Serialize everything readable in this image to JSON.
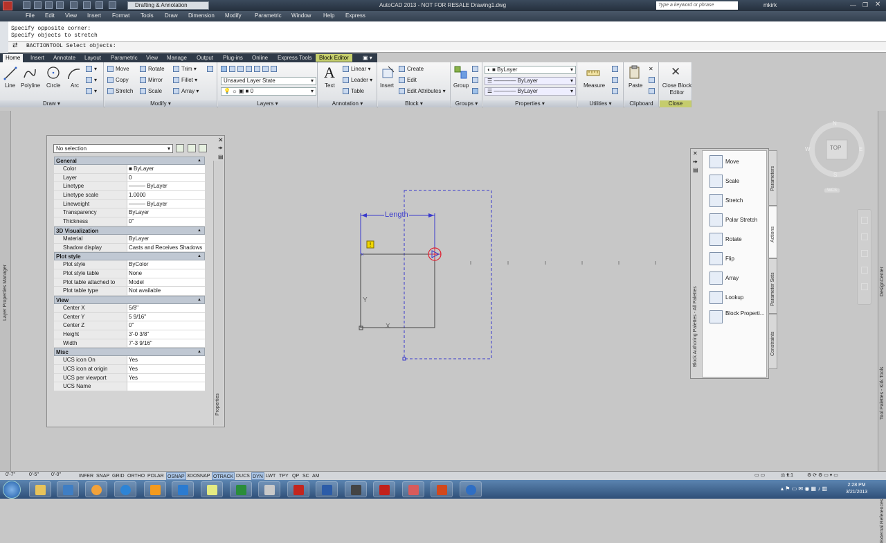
{
  "title_bar": {
    "title": "AutoCAD 2013 - NOT FOR RESALE   Drawing1.dwg",
    "workspace": "Drafting & Annotation",
    "search_placeholder": "Type a keyword or phrase",
    "user": "mkirk"
  },
  "menu": [
    "File",
    "Edit",
    "View",
    "Insert",
    "Format",
    "Tools",
    "Draw",
    "Dimension",
    "Modify",
    "Parametric",
    "Window",
    "Help",
    "Express"
  ],
  "command_line": {
    "history": [
      "Specify opposite corner:",
      "Specify objects to stretch"
    ],
    "prompt": "BACTIONTOOL Select objects:"
  },
  "ribbon_tabs": [
    "Home",
    "Insert",
    "Annotate",
    "Layout",
    "Parametric",
    "View",
    "Manage",
    "Output",
    "Plug-ins",
    "Online",
    "Express Tools",
    "Block Editor"
  ],
  "ribbon": {
    "draw": {
      "line": "Line",
      "polyline": "Polyline",
      "circle": "Circle",
      "arc": "Arc",
      "label": "Draw"
    },
    "modify": {
      "move": "Move",
      "rotate": "Rotate",
      "trim": "Trim",
      "copy": "Copy",
      "mirror": "Mirror",
      "fillet": "Fillet",
      "stretch": "Stretch",
      "scale": "Scale",
      "array": "Array",
      "label": "Modify"
    },
    "layers": {
      "state": "Unsaved Layer State",
      "current": "0",
      "label": "Layers"
    },
    "annotation": {
      "text": "Text",
      "linear": "Linear",
      "leader": "Leader",
      "table": "Table",
      "label": "Annotation"
    },
    "block": {
      "insert": "Insert",
      "create": "Create",
      "edit": "Edit",
      "edit_attributes": "Edit Attributes",
      "label": "Block"
    },
    "groups": {
      "group": "Group",
      "label": "Groups"
    },
    "properties": {
      "color": "ByLayer",
      "linetype": "ByLayer",
      "lineweight": "ByLayer",
      "label": "Properties"
    },
    "utilities": {
      "measure": "Measure",
      "label": "Utilities"
    },
    "clipboard": {
      "paste": "Paste",
      "label": "Clipboard"
    },
    "close": {
      "close_block_editor": "Close Block Editor",
      "label": "Close"
    }
  },
  "properties_palette": {
    "selection": "No selection",
    "side_label": "Properties",
    "sections": [
      {
        "name": "General",
        "rows": [
          [
            "Color",
            "■ ByLayer"
          ],
          [
            "Layer",
            "0"
          ],
          [
            "Linetype",
            "——— ByLayer"
          ],
          [
            "Linetype scale",
            "1.0000"
          ],
          [
            "Lineweight",
            "——— ByLayer"
          ],
          [
            "Transparency",
            "ByLayer"
          ],
          [
            "Thickness",
            "0\""
          ]
        ]
      },
      {
        "name": "3D Visualization",
        "rows": [
          [
            "Material",
            "ByLayer"
          ],
          [
            "Shadow display",
            "Casts and Receives Shadows"
          ]
        ]
      },
      {
        "name": "Plot style",
        "rows": [
          [
            "Plot style",
            "ByColor"
          ],
          [
            "Plot style table",
            "None"
          ],
          [
            "Plot table attached to",
            "Model"
          ],
          [
            "Plot table type",
            "Not available"
          ]
        ]
      },
      {
        "name": "View",
        "rows": [
          [
            "Center X",
            "5/8\""
          ],
          [
            "Center Y",
            "5 9/16\""
          ],
          [
            "Center Z",
            "0\""
          ],
          [
            "Height",
            "3'-0 3/8\""
          ],
          [
            "Width",
            "7'-3 9/16\""
          ]
        ]
      },
      {
        "name": "Misc",
        "rows": [
          [
            "UCS icon On",
            "Yes"
          ],
          [
            "UCS icon at origin",
            "Yes"
          ],
          [
            "UCS per viewport",
            "Yes"
          ],
          [
            "UCS Name",
            ""
          ]
        ]
      }
    ]
  },
  "layer_manager_label": "Layer Properties Manager",
  "drawing": {
    "parameter_label": "Length"
  },
  "authoring_palette": {
    "title": "Block Authoring Palettes - All Palettes",
    "items": [
      "Move",
      "Scale",
      "Stretch",
      "Polar Stretch",
      "Rotate",
      "Flip",
      "Array",
      "Lookup",
      "Block Properti..."
    ],
    "tabs": [
      "Parameters",
      "Actions",
      "Parameter Sets",
      "Constraints"
    ]
  },
  "right_labels": [
    "DesignCenter",
    "Tool Palettes - Kirk Tools",
    "External References"
  ],
  "viewcube": {
    "top": "TOP",
    "n": "N",
    "s": "S",
    "e": "E",
    "w": "W",
    "wcs": "WCS"
  },
  "status_bar": {
    "coords": [
      "0'-7\"",
      "0'-5\"",
      "0'-0\""
    ],
    "toggles": [
      "INFER",
      "SNAP",
      "GRID",
      "ORTHO",
      "POLAR",
      "OSNAP",
      "3DOSNAP",
      "OTRACK",
      "DUCS",
      "DYN",
      "LWT",
      "TPY",
      "QP",
      "SC",
      "AM"
    ],
    "active": [
      "OSNAP",
      "OTRACK",
      "DYN"
    ],
    "scale": "1:1"
  },
  "clock": {
    "time": "2:28 PM",
    "date": "3/21/2013"
  }
}
